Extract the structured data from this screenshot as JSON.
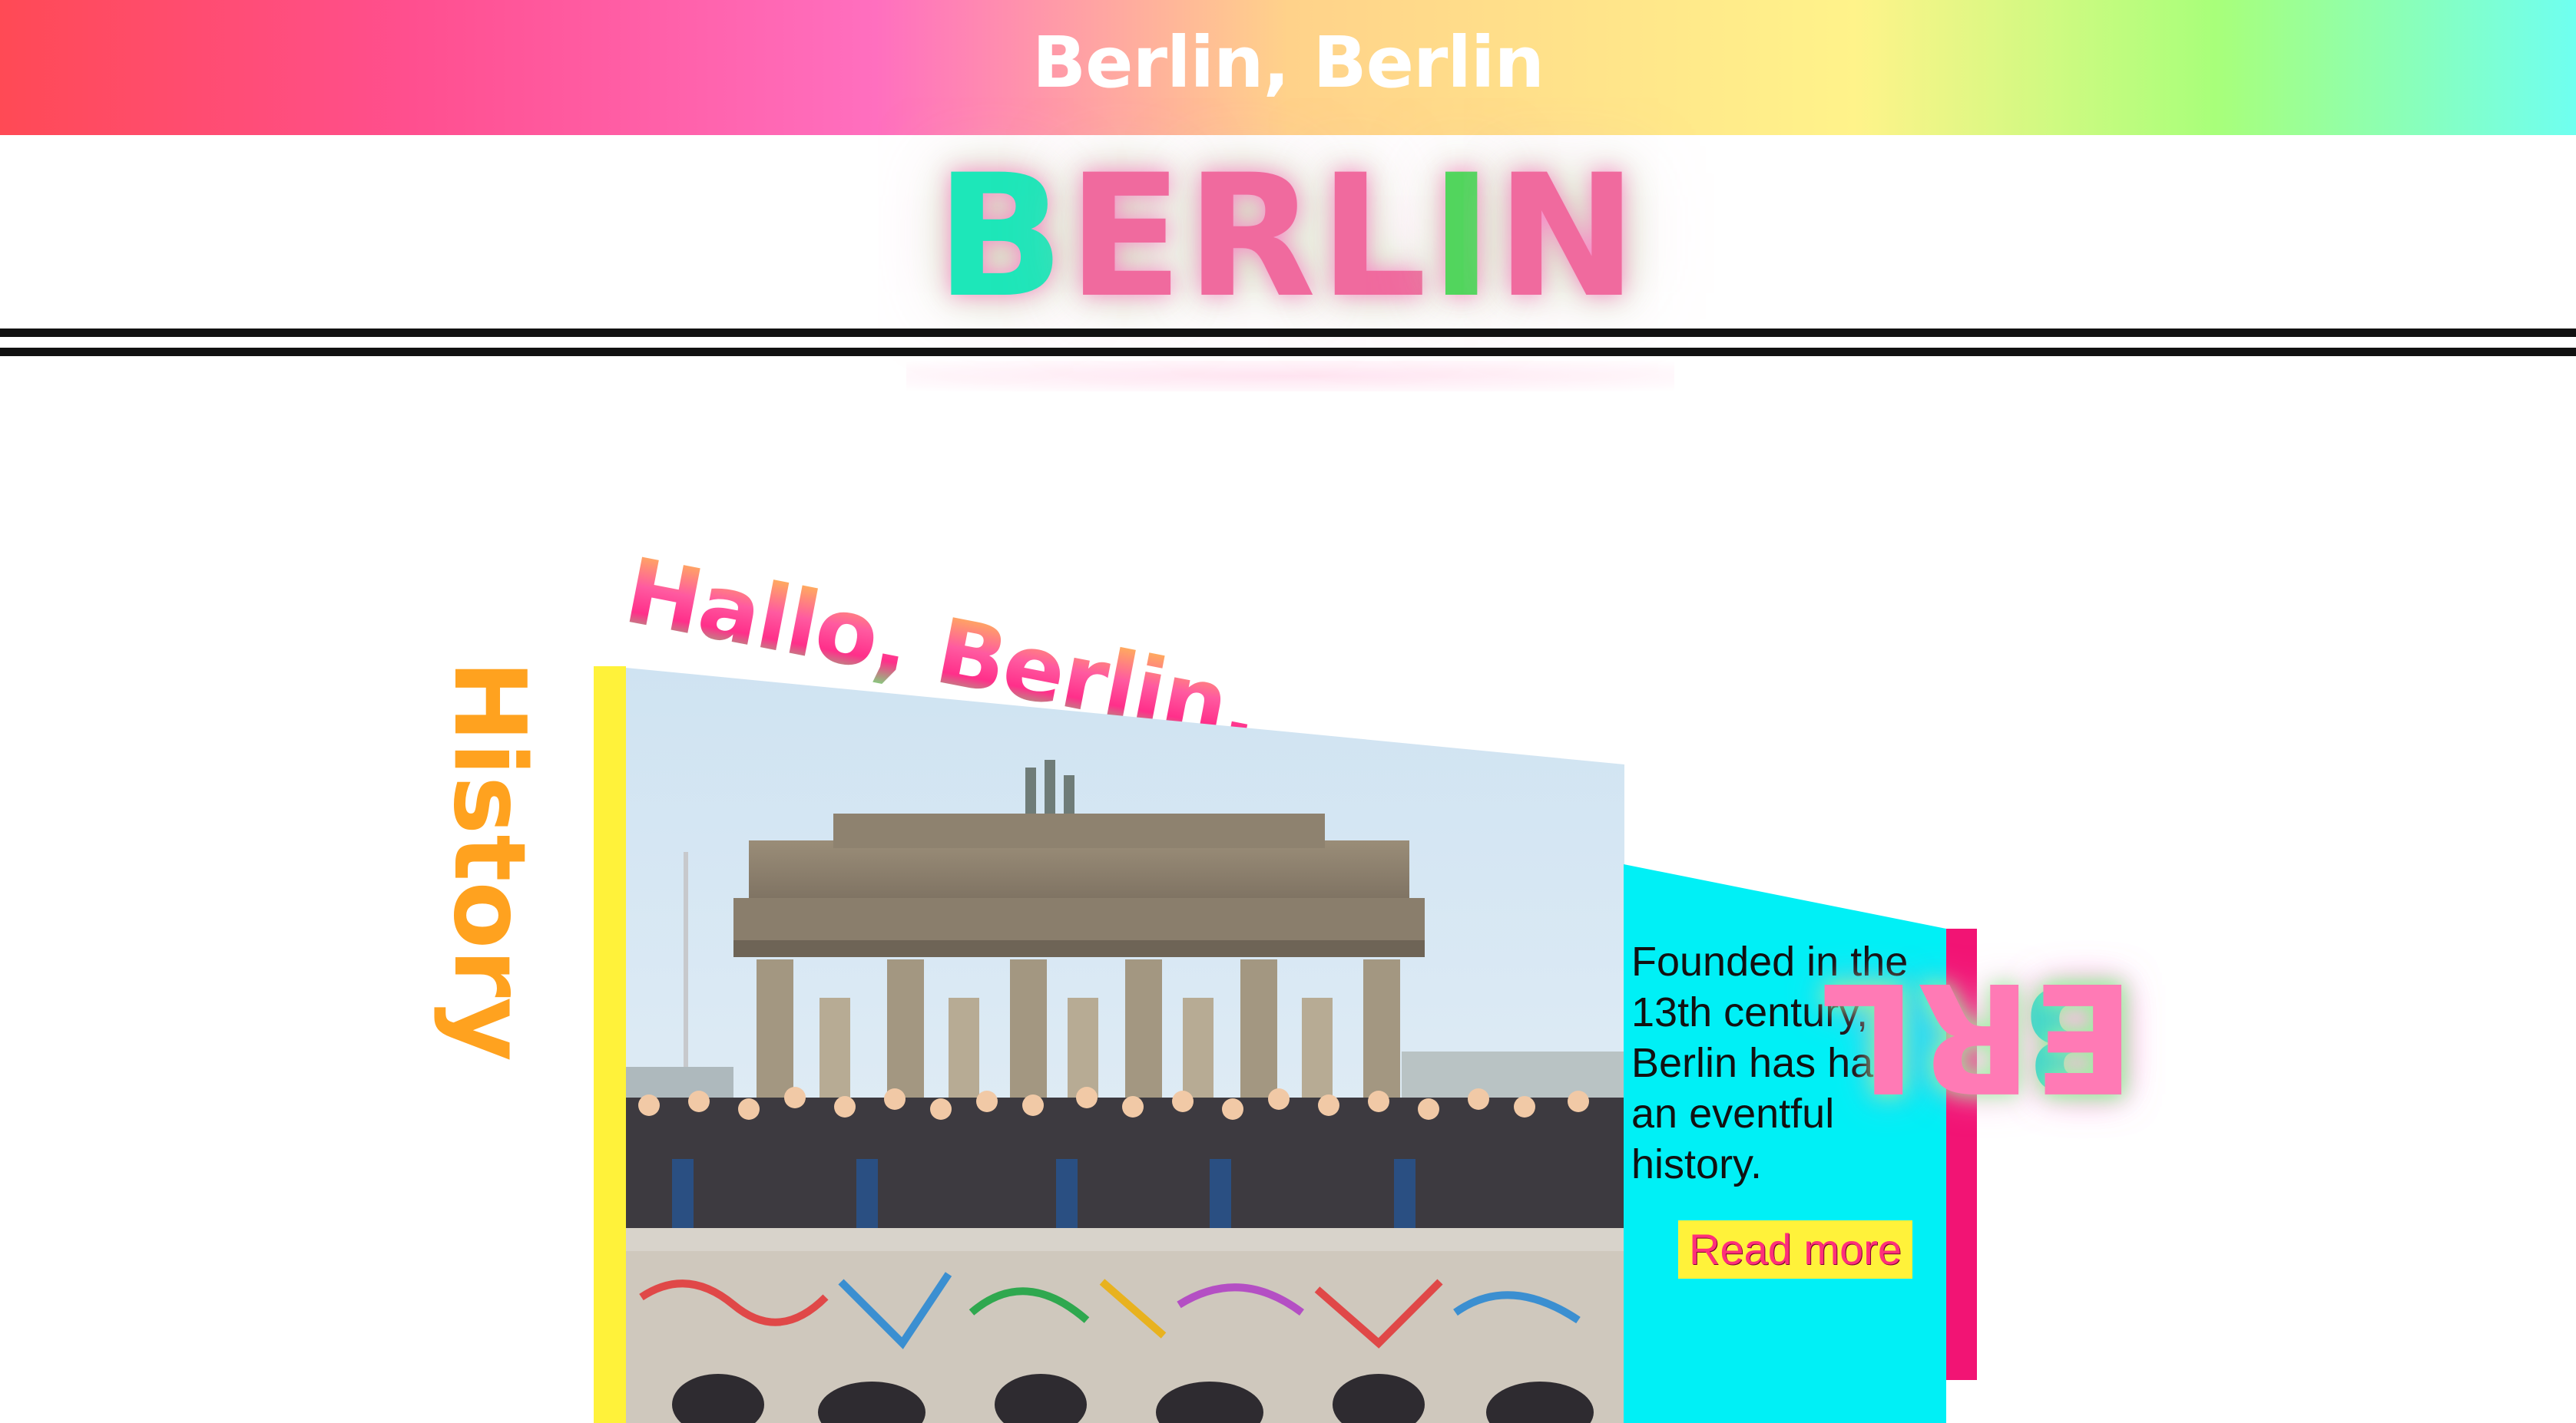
{
  "banner": {
    "title": "Berlin, Berlin"
  },
  "logo": {
    "b": "B",
    "rest1": "ERL",
    "i": "I",
    "rest2": "N"
  },
  "sidebar_label": "History",
  "greeting": "Hallo, Berlin.",
  "card": {
    "text": "Founded in the 13th century, Berlin has had an eventful history.",
    "button_label": "Read more"
  },
  "vertical_word": {
    "first": "B",
    "rest": "ERL"
  },
  "colors": {
    "yellow": "#fff23a",
    "cyan": "#00f0f6",
    "pink": "#f21474",
    "orange": "#ffa21f",
    "teal": "#1de7b9",
    "rose": "#f06a9e"
  }
}
